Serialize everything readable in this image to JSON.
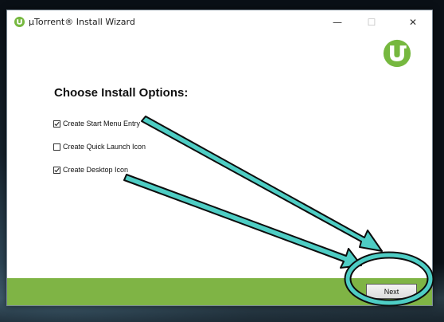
{
  "window": {
    "title": "µTorrent® Install Wizard",
    "minimize_glyph": "—",
    "maximize_glyph": "☐",
    "close_glyph": "✕"
  },
  "main": {
    "heading": "Choose Install Options:",
    "options": [
      {
        "label": "Create Start Menu Entry",
        "checked": true
      },
      {
        "label": "Create Quick Launch Icon",
        "checked": false
      },
      {
        "label": "Create Desktop Icon",
        "checked": true
      }
    ]
  },
  "footer": {
    "next_label": "Next",
    "accent_color": "#7fb445"
  },
  "annotations": {
    "arrow_color": "#4ecdc4",
    "icons": [
      "arrow-annotation-icon",
      "circle-highlight-icon"
    ]
  },
  "colors": {
    "brand_green": "#76b83f"
  }
}
